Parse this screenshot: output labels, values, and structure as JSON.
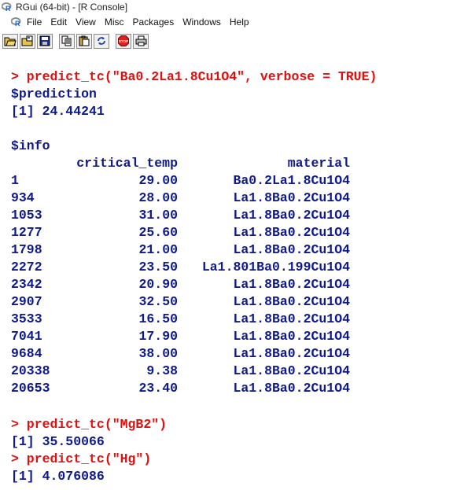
{
  "window": {
    "title": "RGui (64-bit) - [R Console]"
  },
  "menu": [
    "File",
    "Edit",
    "View",
    "Misc",
    "Packages",
    "Windows",
    "Help"
  ],
  "toolbar": {
    "buttons": [
      "open-script-icon",
      "load-workspace-icon",
      "save-workspace-icon",
      "copy-icon",
      "paste-icon",
      "copy-paste-icon",
      "stop-icon",
      "print-icon"
    ],
    "stop_label": "STOP"
  },
  "console": {
    "cmd1": "> predict_tc(\"Ba0.2La1.8Cu1O4\", verbose = TRUE)",
    "prediction_label": "$prediction",
    "prediction_value": "[1] 24.44241",
    "info_label": "$info",
    "col_temp": "critical_temp",
    "col_material": "material",
    "rows": [
      {
        "id": "1",
        "temp": "29.00",
        "material": "Ba0.2La1.8Cu1O4"
      },
      {
        "id": "934",
        "temp": "28.00",
        "material": "La1.8Ba0.2Cu1O4"
      },
      {
        "id": "1053",
        "temp": "31.00",
        "material": "La1.8Ba0.2Cu1O4"
      },
      {
        "id": "1277",
        "temp": "25.60",
        "material": "La1.8Ba0.2Cu1O4"
      },
      {
        "id": "1798",
        "temp": "21.00",
        "material": "La1.8Ba0.2Cu1O4"
      },
      {
        "id": "2272",
        "temp": "23.50",
        "material": "La1.801Ba0.199Cu1O4"
      },
      {
        "id": "2342",
        "temp": "20.90",
        "material": "La1.8Ba0.2Cu1O4"
      },
      {
        "id": "2907",
        "temp": "32.50",
        "material": "La1.8Ba0.2Cu1O4"
      },
      {
        "id": "3533",
        "temp": "16.50",
        "material": "La1.8Ba0.2Cu1O4"
      },
      {
        "id": "7041",
        "temp": "17.90",
        "material": "La1.8Ba0.2Cu1O4"
      },
      {
        "id": "9684",
        "temp": "38.00",
        "material": "La1.8Ba0.2Cu1O4"
      },
      {
        "id": "20338",
        "temp": "9.38",
        "material": "La1.8Ba0.2Cu1O4"
      },
      {
        "id": "20653",
        "temp": "23.40",
        "material": "La1.8Ba0.2Cu1O4"
      }
    ],
    "cmd2": "> predict_tc(\"MgB2\")",
    "out2": "[1] 35.50066",
    "cmd3": "> predict_tc(\"Hg\")",
    "out3": "[1] 4.076086"
  },
  "colors": {
    "command": "#e01010",
    "output": "#0e1a8c"
  }
}
